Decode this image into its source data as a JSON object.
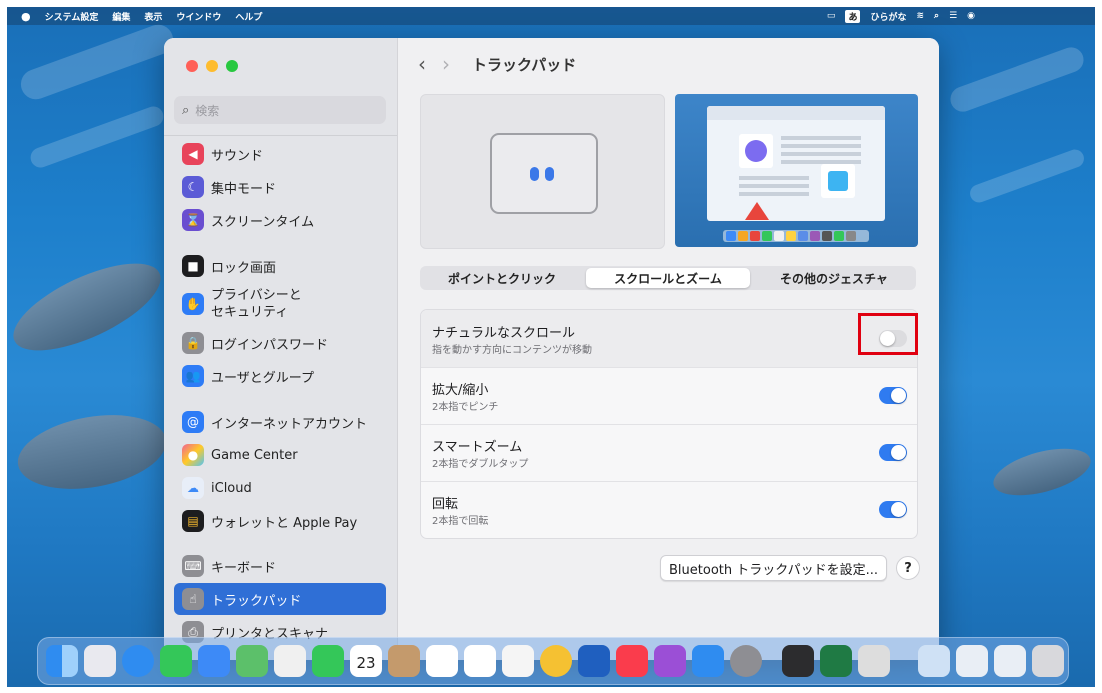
{
  "menubar": {
    "apple": "",
    "items": [
      "システム設定",
      "編集",
      "表示",
      "ウインドウ",
      "ヘルプ"
    ],
    "ime_badge": "あ",
    "ime_label": "ひらがな"
  },
  "sidebar": {
    "search_placeholder": "検索",
    "items": [
      {
        "label": "サウンド",
        "icon": "speaker-icon",
        "color": "#e8435a"
      },
      {
        "label": "集中モード",
        "icon": "moon-icon",
        "color": "#5b5bd6"
      },
      {
        "label": "スクリーンタイム",
        "icon": "hourglass-icon",
        "color": "#6a4ed0"
      },
      {
        "label": "ロック画面",
        "icon": "lock-screen-icon",
        "color": "#1d1d1f"
      },
      {
        "label": "プライバシーと",
        "label2": "セキュリティ",
        "icon": "hand-icon",
        "color": "#2e7cf6"
      },
      {
        "label": "ログインパスワード",
        "icon": "lock-icon",
        "color": "#8e8e93"
      },
      {
        "label": "ユーザとグループ",
        "icon": "users-icon",
        "color": "#2e7cf6"
      },
      {
        "label": "インターネットアカウント",
        "icon": "at-icon",
        "color": "#2e7cf6"
      },
      {
        "label": "Game Center",
        "icon": "game-center-icon",
        "color": "#f06292"
      },
      {
        "label": "iCloud",
        "icon": "cloud-icon",
        "color": "#e8eef8"
      },
      {
        "label": "ウォレットと Apple Pay",
        "icon": "wallet-icon",
        "color": "#1d1d1f"
      },
      {
        "label": "キーボード",
        "icon": "keyboard-icon",
        "color": "#8e8e93"
      },
      {
        "label": "トラックパッド",
        "icon": "trackpad-icon",
        "color": "#8e8e93"
      },
      {
        "label": "プリンタとスキャナ",
        "icon": "printer-icon",
        "color": "#8e8e93"
      }
    ]
  },
  "main": {
    "title": "トラックパッド",
    "tabs": [
      "ポイントとクリック",
      "スクロールとズーム",
      "その他のジェスチャ"
    ],
    "active_tab": 1,
    "settings": [
      {
        "title": "ナチュラルなスクロール",
        "subtitle": "指を動かす方向にコンテンツが移動",
        "enabled": false
      },
      {
        "title": "拡大/縮小",
        "subtitle": "2本指でピンチ",
        "enabled": true
      },
      {
        "title": "スマートズーム",
        "subtitle": "2本指でダブルタップ",
        "enabled": true
      },
      {
        "title": "回転",
        "subtitle": "2本指で回転",
        "enabled": true
      }
    ],
    "bluetooth_button": "Bluetooth トラックパッドを設定...",
    "help_button": "?"
  },
  "dock": {
    "calendar_day": "23"
  },
  "colors": {
    "accent": "#2f6fd6",
    "toggle_on": "#2f7bf0",
    "highlight": "#e00010"
  }
}
